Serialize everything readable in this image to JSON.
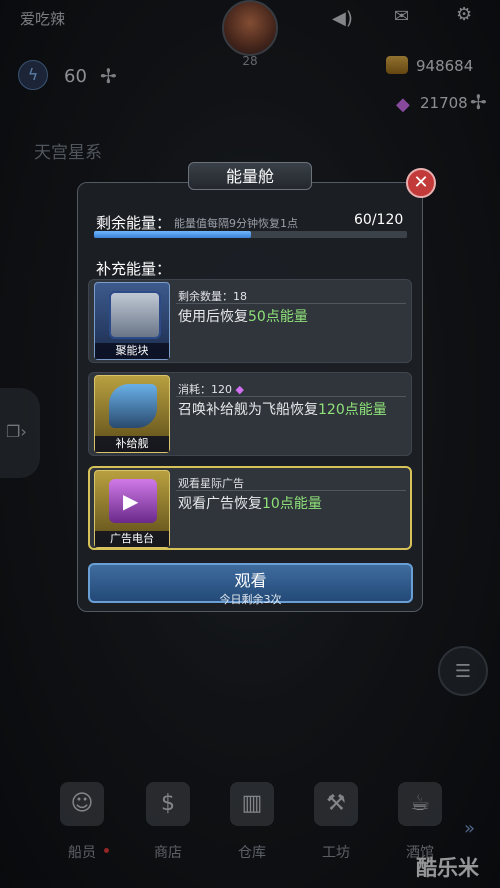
{
  "topbar": {
    "player_name": "爱吃辣",
    "level": "28",
    "energy": "60",
    "energy_add": "✢",
    "gold": "948684",
    "gems": "21708",
    "gem_add": "✢",
    "galaxy": "天宫星系"
  },
  "modal": {
    "title": "能量舱",
    "remaining_label": "剩余能量：",
    "remaining_hint": "能量值每隔9分钟恢复1点",
    "remaining_value": "60/120",
    "energy_ratio": 0.5,
    "supplement_label": "补充能量：",
    "items": [
      {
        "thumb_label": "聚能块",
        "line1": "剩余数量：18",
        "line2_prefix": "使用后恢复",
        "line2_highlight": "50点能量"
      },
      {
        "thumb_label": "补给舰",
        "line1": "消耗：120",
        "line2_prefix": "召唤补给舰为飞船恢复",
        "line2_highlight": "120点能量"
      },
      {
        "thumb_label": "广告电台",
        "line1": "观看星际广告",
        "line2_prefix": "观看广告恢复",
        "line2_highlight": "10点能量"
      }
    ],
    "watch_button": "观看",
    "watch_sub": "今日剩余3次"
  },
  "nav": {
    "items": [
      "船员",
      "商店",
      "仓库",
      "工坊",
      "酒馆"
    ]
  },
  "watermark": "酷乐米",
  "colors": {
    "accent": "#3f6c9e",
    "highlight": "#8fe27a",
    "close": "#c23a3a",
    "selected_border": "#d7c25a"
  }
}
